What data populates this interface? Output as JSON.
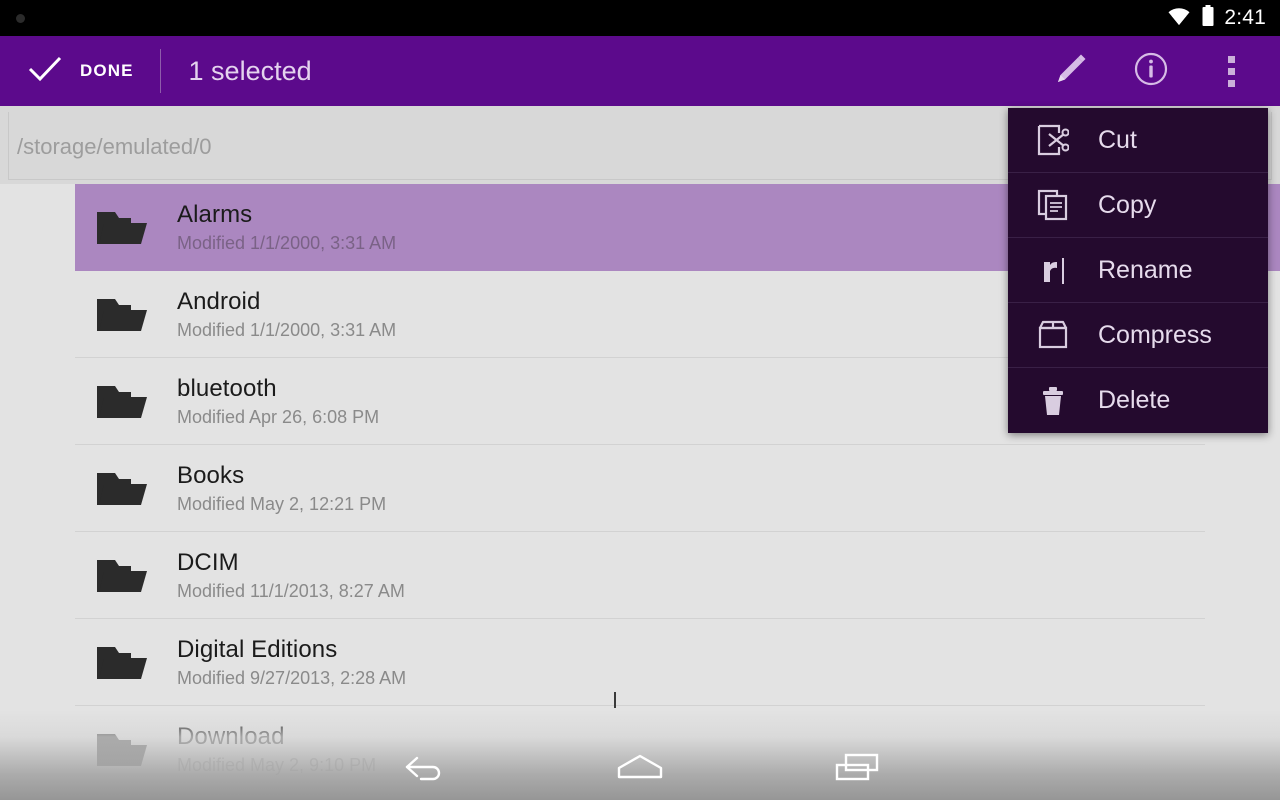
{
  "statusbar": {
    "dot_icon": "notification-dot",
    "wifi_icon": "wifi-icon",
    "battery_icon": "battery-icon",
    "clock": "2:41"
  },
  "actionbar": {
    "check_icon": "check-icon",
    "done_label": "DONE",
    "selected_label": "1 selected",
    "edit_icon": "pencil-icon",
    "info_icon": "info-circle-icon",
    "overflow_icon": "overflow-menu-icon",
    "background_color": "#5c0a8c"
  },
  "pathbar": {
    "path": "/storage/emulated/0"
  },
  "filelist": {
    "highlight_color": "#ab87c0",
    "background_color": "#e3e3e3",
    "folder_icon": "folder-icon",
    "rows": [
      {
        "name": "Alarms",
        "meta": "Modified 1/1/2000, 3:31 AM",
        "selected": true
      },
      {
        "name": "Android",
        "meta": "Modified 1/1/2000, 3:31 AM",
        "selected": false
      },
      {
        "name": "bluetooth",
        "meta": "Modified Apr 26, 6:08 PM",
        "selected": false
      },
      {
        "name": "Books",
        "meta": "Modified May 2, 12:21 PM",
        "selected": false
      },
      {
        "name": "DCIM",
        "meta": "Modified 11/1/2013, 8:27 AM",
        "selected": false
      },
      {
        "name": "Digital Editions",
        "meta": "Modified 9/27/2013, 2:28 AM",
        "selected": false
      },
      {
        "name": "Download",
        "meta": "Modified May 2, 9:10 PM",
        "selected": false
      }
    ]
  },
  "menu": {
    "background_color": "#240a2e",
    "items": [
      {
        "label": "Cut",
        "icon": "cut-icon"
      },
      {
        "label": "Copy",
        "icon": "copy-icon"
      },
      {
        "label": "Rename",
        "icon": "rename-icon"
      },
      {
        "label": "Compress",
        "icon": "compress-icon"
      },
      {
        "label": "Delete",
        "icon": "delete-icon"
      }
    ]
  },
  "navbar": {
    "back_icon": "back-arrow-icon",
    "home_icon": "home-icon",
    "recents_icon": "recents-icon"
  }
}
